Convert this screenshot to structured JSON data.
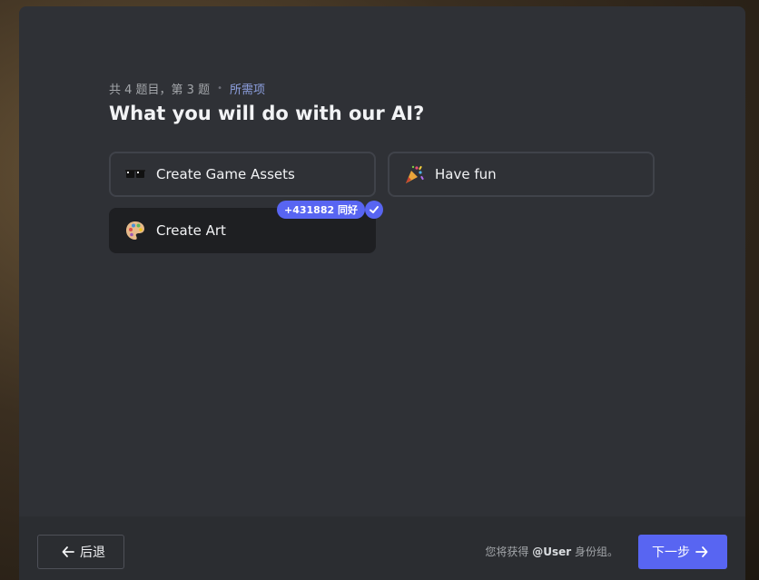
{
  "progress": {
    "counter": "共 4 题目，第 3 题",
    "separator": "•",
    "required": "所需项"
  },
  "question": {
    "title": "What you will do with our AI?"
  },
  "options": [
    {
      "label": "Create Game Assets",
      "icon": "sunglasses-icon",
      "selected": false
    },
    {
      "label": "Have fun",
      "icon": "party-popper-icon",
      "selected": false
    },
    {
      "label": "Create Art",
      "icon": "palette-icon",
      "selected": true,
      "badge": "+431882 同好"
    }
  ],
  "footer": {
    "back_label": "后退",
    "role_prefix": "您将获得",
    "role_mention": "@User",
    "role_suffix": "身份组。",
    "next_label": "下一步"
  },
  "colors": {
    "accent": "#5865f2",
    "modal_bg": "#2f3136",
    "selected_bg": "#1e1f22",
    "required_text": "#8ea1e1"
  }
}
